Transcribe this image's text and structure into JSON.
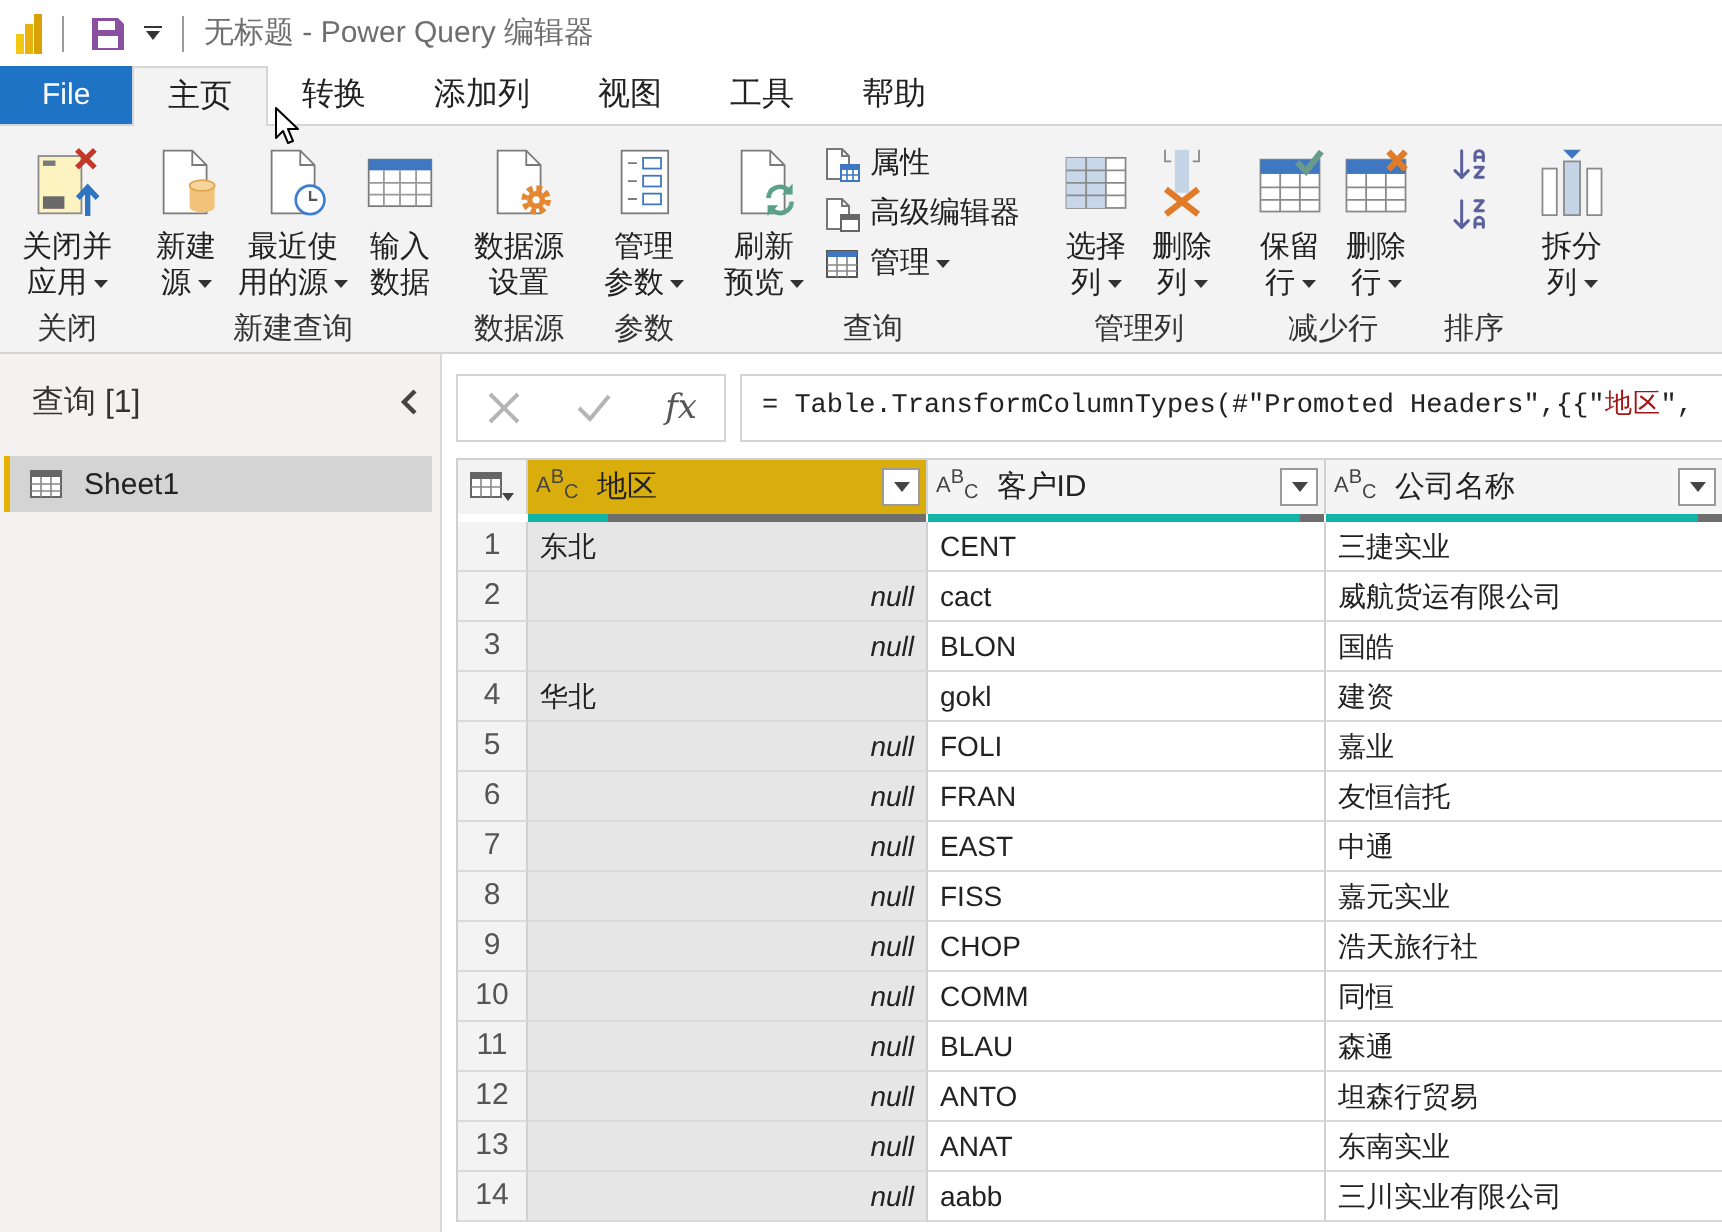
{
  "window": {
    "title": "无标题 - Power Query 编辑器"
  },
  "tabs": [
    {
      "label": "File",
      "kind": "file",
      "selected": false
    },
    {
      "label": "主页",
      "kind": "tab",
      "selected": true
    },
    {
      "label": "转换",
      "kind": "tab",
      "selected": false
    },
    {
      "label": "添加列",
      "kind": "tab",
      "selected": false
    },
    {
      "label": "视图",
      "kind": "tab",
      "selected": false
    },
    {
      "label": "工具",
      "kind": "tab",
      "selected": false
    },
    {
      "label": "帮助",
      "kind": "tab",
      "selected": false
    }
  ],
  "ribbon": {
    "groups": [
      {
        "label": "关闭",
        "items": [
          {
            "kind": "large",
            "lines": [
              "关闭并",
              "应用"
            ],
            "dropdown": true
          }
        ]
      },
      {
        "label": "新建查询",
        "items": [
          {
            "kind": "large",
            "lines": [
              "新建",
              "源"
            ],
            "dropdown": true
          },
          {
            "kind": "large",
            "lines": [
              "最近使",
              "用的源"
            ],
            "dropdown": true
          },
          {
            "kind": "large",
            "lines": [
              "输入",
              "数据"
            ],
            "dropdown": false
          }
        ]
      },
      {
        "label": "数据源",
        "items": [
          {
            "kind": "large",
            "lines": [
              "数据源",
              "设置"
            ],
            "dropdown": false
          }
        ]
      },
      {
        "label": "参数",
        "items": [
          {
            "kind": "large",
            "lines": [
              "管理",
              "参数"
            ],
            "dropdown": true
          }
        ]
      },
      {
        "label": "查询",
        "items": [
          {
            "kind": "large",
            "lines": [
              "刷新",
              "预览"
            ],
            "dropdown": true
          },
          {
            "kind": "small",
            "lines": [
              "属性"
            ],
            "dropdown": false
          },
          {
            "kind": "small",
            "lines": [
              "高级编辑器"
            ],
            "dropdown": false
          },
          {
            "kind": "small",
            "lines": [
              "管理"
            ],
            "dropdown": true
          }
        ]
      },
      {
        "label": "管理列",
        "items": [
          {
            "kind": "large",
            "lines": [
              "选择",
              "列"
            ],
            "dropdown": true
          },
          {
            "kind": "large",
            "lines": [
              "删除",
              "列"
            ],
            "dropdown": true
          }
        ]
      },
      {
        "label": "减少行",
        "items": [
          {
            "kind": "large",
            "lines": [
              "保留",
              "行"
            ],
            "dropdown": true
          },
          {
            "kind": "large",
            "lines": [
              "删除",
              "行"
            ],
            "dropdown": true
          }
        ]
      },
      {
        "label": "排序",
        "items": [
          {
            "kind": "icon"
          },
          {
            "kind": "icon"
          }
        ]
      },
      {
        "items": [
          {
            "kind": "large",
            "lines": [
              "拆分",
              "列"
            ],
            "dropdown": true
          }
        ]
      }
    ]
  },
  "left_panel": {
    "title": "查询 [1]",
    "queries": [
      {
        "name": "Sheet1",
        "selected": true
      }
    ]
  },
  "formula_bar": {
    "cancel": {
      "disabled": true
    },
    "commit": {
      "disabled": true
    },
    "function_label": "fx",
    "formula": [
      {
        "text": "= Table.TransformColumnTypes(#\"Promoted Headers\",{{\"",
        "kind": "code"
      },
      {
        "text": "地区",
        "kind": "string"
      },
      {
        "text": "\",",
        "kind": "code"
      }
    ]
  },
  "table": {
    "columns": [
      {
        "type": "A$^{B}$$_{C}$",
        "name": "地区",
        "selected": true,
        "level": 0.2
      },
      {
        "type": "A$^{B}$$_{C}$",
        "name": "客户ID",
        "selected": false,
        "level": 0.94
      },
      {
        "type": "A$^{B}$$_{C}$",
        "name": "公司名称",
        "selected": false,
        "level": 0.94
      }
    ],
    "rows": [
      {
        "number": "1",
        "cells": [
          {
            "text": "东北",
            "is_null": false
          },
          {
            "text": "CENT",
            "is_null": false
          },
          {
            "text": "三捷实业",
            "is_null": false
          }
        ]
      },
      {
        "number": "2",
        "cells": [
          {
            "text": "null",
            "is_null": true
          },
          {
            "text": "cact",
            "is_null": false
          },
          {
            "text": "威航货运有限公司",
            "is_null": false
          }
        ]
      },
      {
        "number": "3",
        "cells": [
          {
            "text": "null",
            "is_null": true
          },
          {
            "text": "BLON",
            "is_null": false
          },
          {
            "text": "国皓",
            "is_null": false
          }
        ]
      },
      {
        "number": "4",
        "cells": [
          {
            "text": "华北",
            "is_null": false
          },
          {
            "text": "gokl",
            "is_null": false
          },
          {
            "text": "建资",
            "is_null": false
          }
        ]
      },
      {
        "number": "5",
        "cells": [
          {
            "text": "null",
            "is_null": true
          },
          {
            "text": "FOLI",
            "is_null": false
          },
          {
            "text": "嘉业",
            "is_null": false
          }
        ]
      },
      {
        "number": "6",
        "cells": [
          {
            "text": "null",
            "is_null": true
          },
          {
            "text": "FRAN",
            "is_null": false
          },
          {
            "text": "友恒信托",
            "is_null": false
          }
        ]
      },
      {
        "number": "7",
        "cells": [
          {
            "text": "null",
            "is_null": true
          },
          {
            "text": "EAST",
            "is_null": false
          },
          {
            "text": "中通",
            "is_null": false
          }
        ]
      },
      {
        "number": "8",
        "cells": [
          {
            "text": "null",
            "is_null": true
          },
          {
            "text": "FISS",
            "is_null": false
          },
          {
            "text": "嘉元实业",
            "is_null": false
          }
        ]
      },
      {
        "number": "9",
        "cells": [
          {
            "text": "null",
            "is_null": true
          },
          {
            "text": "CHOP",
            "is_null": false
          },
          {
            "text": "浩天旅行社",
            "is_null": false
          }
        ]
      },
      {
        "number": "10",
        "cells": [
          {
            "text": "null",
            "is_null": true
          },
          {
            "text": "COMM",
            "is_null": false
          },
          {
            "text": "同恒",
            "is_null": false
          }
        ]
      },
      {
        "number": "11",
        "cells": [
          {
            "text": "null",
            "is_null": true
          },
          {
            "text": "BLAU",
            "is_null": false
          },
          {
            "text": "森通",
            "is_null": false
          }
        ]
      },
      {
        "number": "12",
        "cells": [
          {
            "text": "null",
            "is_null": true
          },
          {
            "text": "ANTO",
            "is_null": false
          },
          {
            "text": "坦森行贸易",
            "is_null": false
          }
        ]
      },
      {
        "number": "13",
        "cells": [
          {
            "text": "null",
            "is_null": true
          },
          {
            "text": "ANAT",
            "is_null": false
          },
          {
            "text": "东南实业",
            "is_null": false
          }
        ]
      },
      {
        "number": "14",
        "cells": [
          {
            "text": "null",
            "is_null": true
          },
          {
            "text": "aabb",
            "is_null": false
          },
          {
            "text": "三川实业有限公司",
            "is_null": false
          }
        ]
      }
    ]
  }
}
